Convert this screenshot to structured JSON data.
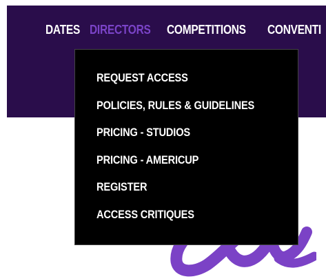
{
  "nav": {
    "items": [
      {
        "label": "DATES"
      },
      {
        "label": "DIRECTORS"
      },
      {
        "label": "COMPETITIONS"
      },
      {
        "label": "CONVENTI"
      }
    ]
  },
  "dropdown": {
    "items": [
      {
        "label": "REQUEST ACCESS"
      },
      {
        "label": "POLICIES, RULES & GUIDELINES"
      },
      {
        "label": "PRICING - STUDIOS"
      },
      {
        "label": "PRICING - AMERICUP"
      },
      {
        "label": "REGISTER"
      },
      {
        "label": "ACCESS CRITIQUES"
      }
    ]
  },
  "colors": {
    "nav_background": "#2a0d4b",
    "active_nav": "#7a43c7",
    "dropdown_background": "#000000",
    "script_logo": "#7b42c6"
  },
  "icons": {
    "logo": "script-wordmark-fragment"
  }
}
